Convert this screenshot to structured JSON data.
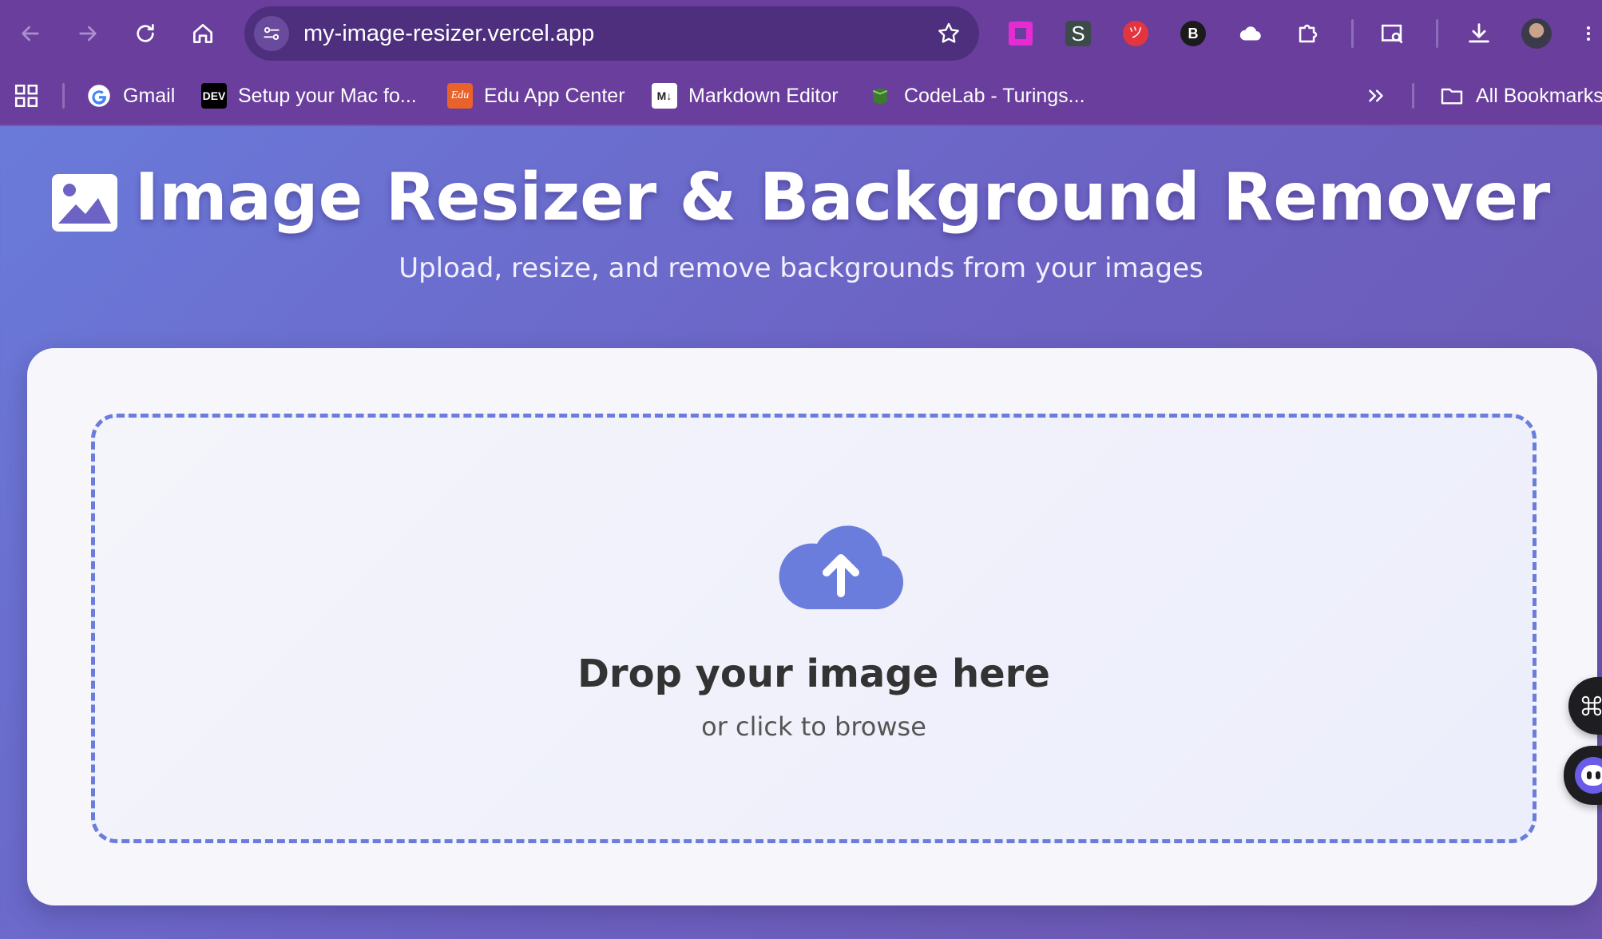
{
  "browser": {
    "url": "my-image-resizer.vercel.app",
    "extensions": [
      "pink-square-extension-icon",
      "s-extension-icon",
      "red-extension-icon",
      "black-extension-icon",
      "cloud-extension-icon",
      "puzzle-extensions-icon"
    ],
    "bookmarks": [
      {
        "label": "Gmail",
        "icon": "google-icon"
      },
      {
        "label": "Setup your Mac fo...",
        "icon": "dev-icon",
        "badge": "DEV"
      },
      {
        "label": "Edu App Center",
        "icon": "edu-icon",
        "badge": "Edu"
      },
      {
        "label": "Markdown Editor",
        "icon": "markdown-icon",
        "badge": "M↓"
      },
      {
        "label": "CodeLab - Turings...",
        "icon": "codelab-icon"
      }
    ],
    "all_bookmarks_label": "All Bookmarks"
  },
  "page": {
    "title": "Image Resizer & Background Remover",
    "subtitle": "Upload, resize, and remove backgrounds from your images",
    "dropzone": {
      "title": "Drop your image here",
      "subtitle": "or click to browse"
    }
  },
  "colors": {
    "chrome": "#6a3e9c",
    "omnibox": "#4d2f7e",
    "accent": "#6a7ddc",
    "card": "#f6f6fb"
  }
}
